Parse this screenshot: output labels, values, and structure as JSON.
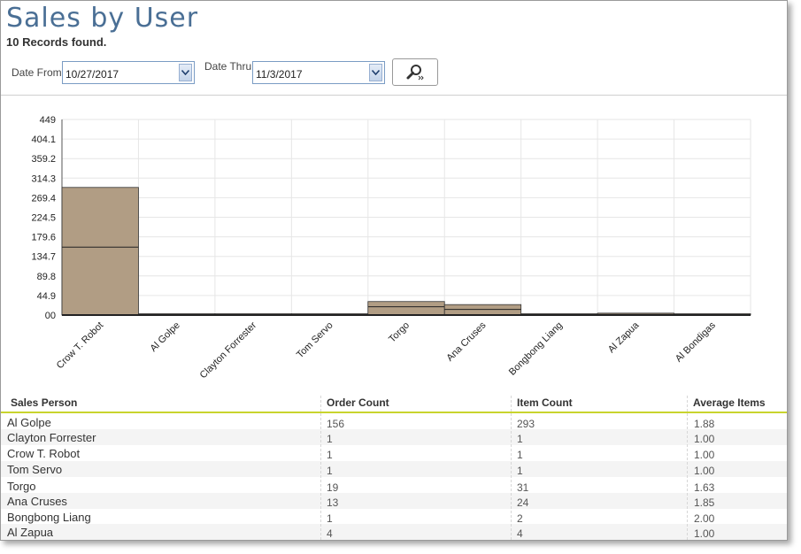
{
  "page": {
    "title": "Sales by User",
    "records": "10 Records found."
  },
  "filters": {
    "date_from_label": "Date From",
    "date_from_value": "10/27/2017",
    "date_thru_label": "Date Thru",
    "date_thru_value": "11/3/2017"
  },
  "icons": {
    "dropdown": "chevron-down-icon",
    "search": "magnifier-icon"
  },
  "chart_data": {
    "type": "bar",
    "ylim": [
      0,
      449
    ],
    "yticks": [
      "449",
      "404.1",
      "359.2",
      "314.3",
      "269.4",
      "224.5",
      "179.6",
      "134.7",
      "89.8",
      "44.9",
      "00"
    ],
    "categories": [
      "Crow T. Robot",
      "Al Golpe",
      "Clayton Forrester",
      "Tom Servo",
      "Torgo",
      "Ana Cruses",
      "Bongbong Liang",
      "Al Zapua",
      "Al Bondigas"
    ],
    "series": [
      {
        "values": [
          156,
          1,
          1,
          1,
          19,
          13,
          1,
          4,
          1
        ]
      },
      {
        "values": [
          293,
          1,
          1,
          1,
          31,
          24,
          2,
          4,
          1
        ]
      }
    ],
    "bar_color": "#b19d84",
    "grid": true
  },
  "table": {
    "headers": [
      "Sales Person",
      "Order Count",
      "Item Count",
      "Average Items"
    ],
    "rows": [
      [
        "Al Golpe",
        "156",
        "293",
        "1.88"
      ],
      [
        "Clayton Forrester",
        "1",
        "1",
        "1.00"
      ],
      [
        "Crow T. Robot",
        "1",
        "1",
        "1.00"
      ],
      [
        "Tom Servo",
        "1",
        "1",
        "1.00"
      ],
      [
        "Torgo",
        "19",
        "31",
        "1.63"
      ],
      [
        "Ana Cruses",
        "13",
        "24",
        "1.85"
      ],
      [
        "Bongbong Liang",
        "1",
        "2",
        "2.00"
      ],
      [
        "Al Zapua",
        "4",
        "4",
        "1.00"
      ]
    ]
  }
}
